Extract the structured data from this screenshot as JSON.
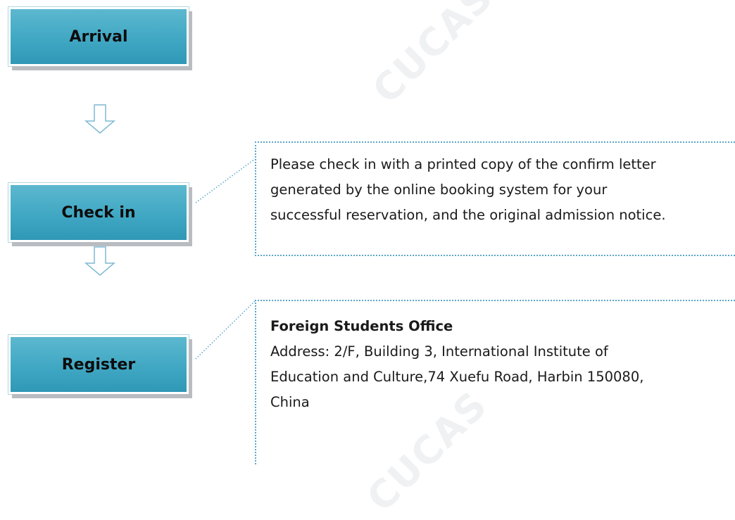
{
  "steps": [
    {
      "label": "Arrival"
    },
    {
      "label": "Check in"
    },
    {
      "label": "Register"
    }
  ],
  "check_in_note": {
    "lines": [
      "Please check in with a printed copy of the confirm letter",
      "generated by the online booking system for your",
      "successful reservation, and the original admission notice."
    ]
  },
  "register_note": {
    "heading": "Foreign Students Office",
    "lines": [
      "Address: 2/F, Building 3, International Institute of",
      "Education and Culture,74 Xuefu Road, Harbin 150080,",
      "China"
    ]
  },
  "watermark": {
    "text": "CUCAS"
  },
  "colors": {
    "step_fill": "#3ea6c2",
    "dotted": "#5aa6c9",
    "arrow": "#7fb8d4"
  }
}
